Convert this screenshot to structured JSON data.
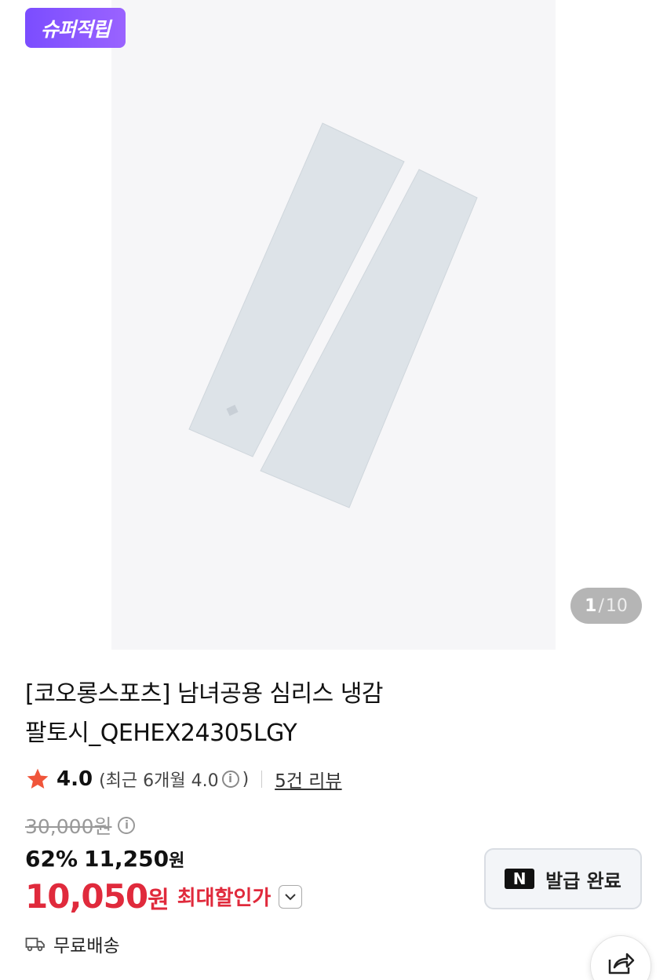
{
  "gallery": {
    "badge": "슈퍼적립",
    "counter": {
      "current": "1",
      "separator": "/",
      "total": "10"
    }
  },
  "product": {
    "title_line1": "[코오롱스포츠] 남녀공용 심리스 냉감",
    "title_line2": "팔토시_QEHEX24305LGY"
  },
  "rating": {
    "score": "4.0",
    "recent_label": "(최근 6개월 4.0",
    "recent_close": ")",
    "reviews": "5건 리뷰",
    "star_color": "#f0553a"
  },
  "price": {
    "original": "30,000원",
    "discount": "62%",
    "sale_amount": "11,250",
    "sale_unit": "원",
    "max_amount": "10,050",
    "max_unit": "원",
    "max_label": "최대할인가",
    "accent_color": "#e02a3c"
  },
  "coupon": {
    "logo": "N",
    "label": "발급 완료"
  },
  "shipping": {
    "label": "무료배송",
    "icon": "truck-icon"
  },
  "share": {
    "icon": "share-icon"
  }
}
